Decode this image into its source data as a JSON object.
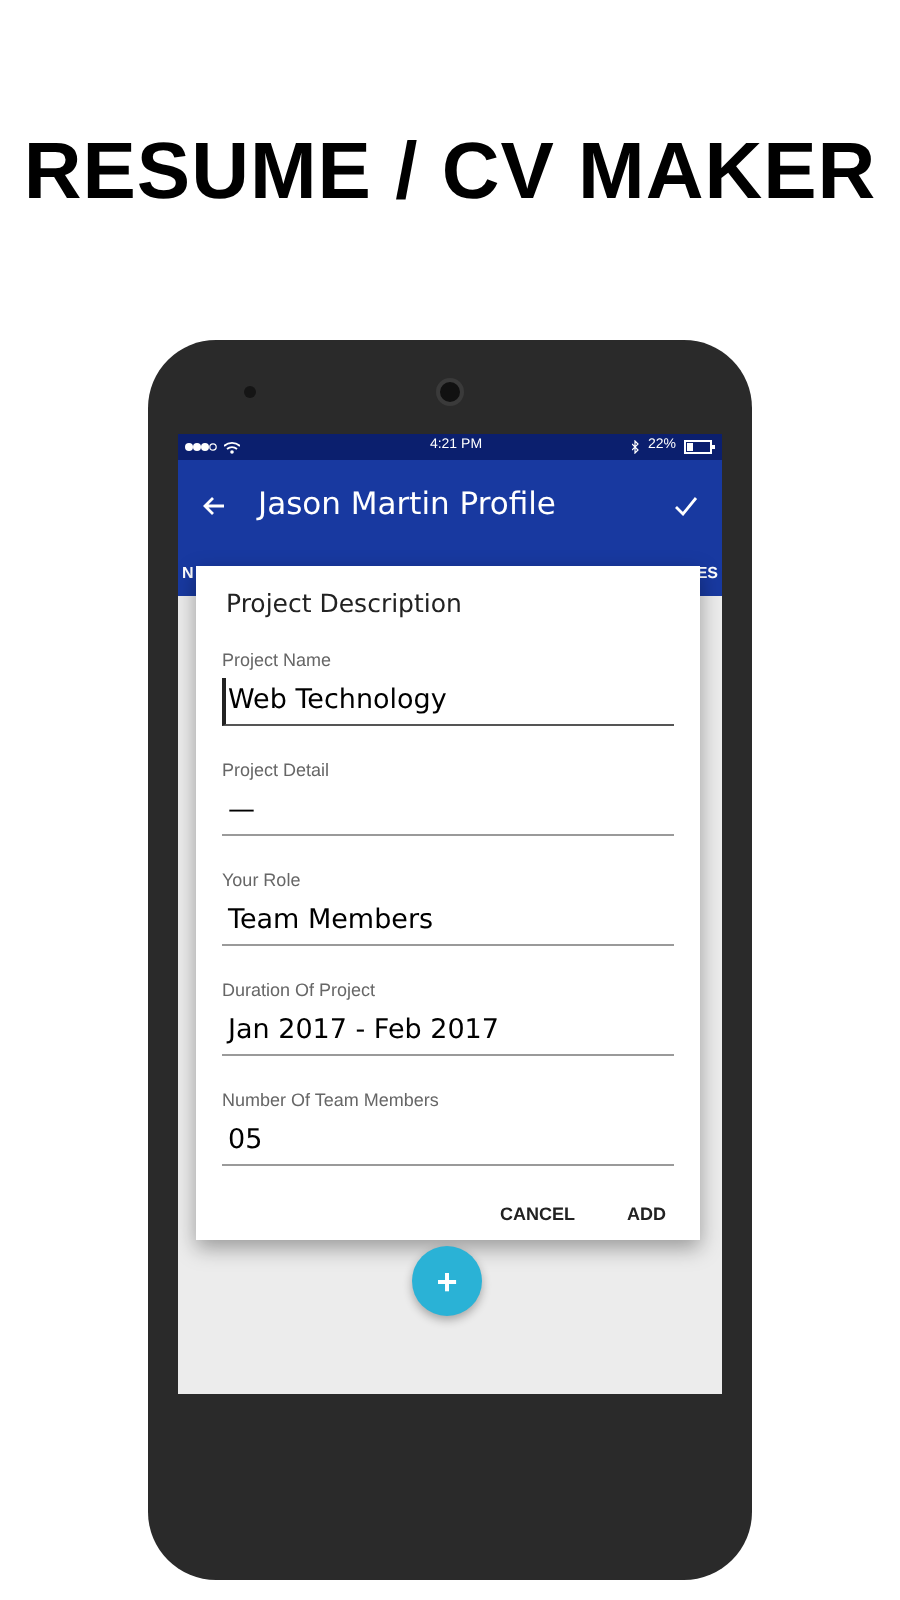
{
  "headline": "RESUME / CV MAKER",
  "status_bar": {
    "time": "4:21 PM",
    "battery": "22%"
  },
  "app_bar": {
    "title": "Jason Martin Profile"
  },
  "tabs": [
    {
      "label": "N"
    },
    {
      "label": "ES"
    }
  ],
  "dialog": {
    "title": "Project Description",
    "fields": [
      {
        "label": "Project Name",
        "value": "Web Technology",
        "focused": true
      },
      {
        "label": "Project Detail",
        "value": "—",
        "focused": false
      },
      {
        "label": "Your Role",
        "value": "Team Members",
        "focused": false
      },
      {
        "label": "Duration Of Project",
        "value": "Jan 2017 - Feb 2017",
        "focused": false
      },
      {
        "label": "Number Of Team Members",
        "value": "05",
        "focused": false
      }
    ],
    "buttons": [
      "CANCEL",
      "ADD"
    ]
  },
  "fab": {
    "label": "+"
  }
}
